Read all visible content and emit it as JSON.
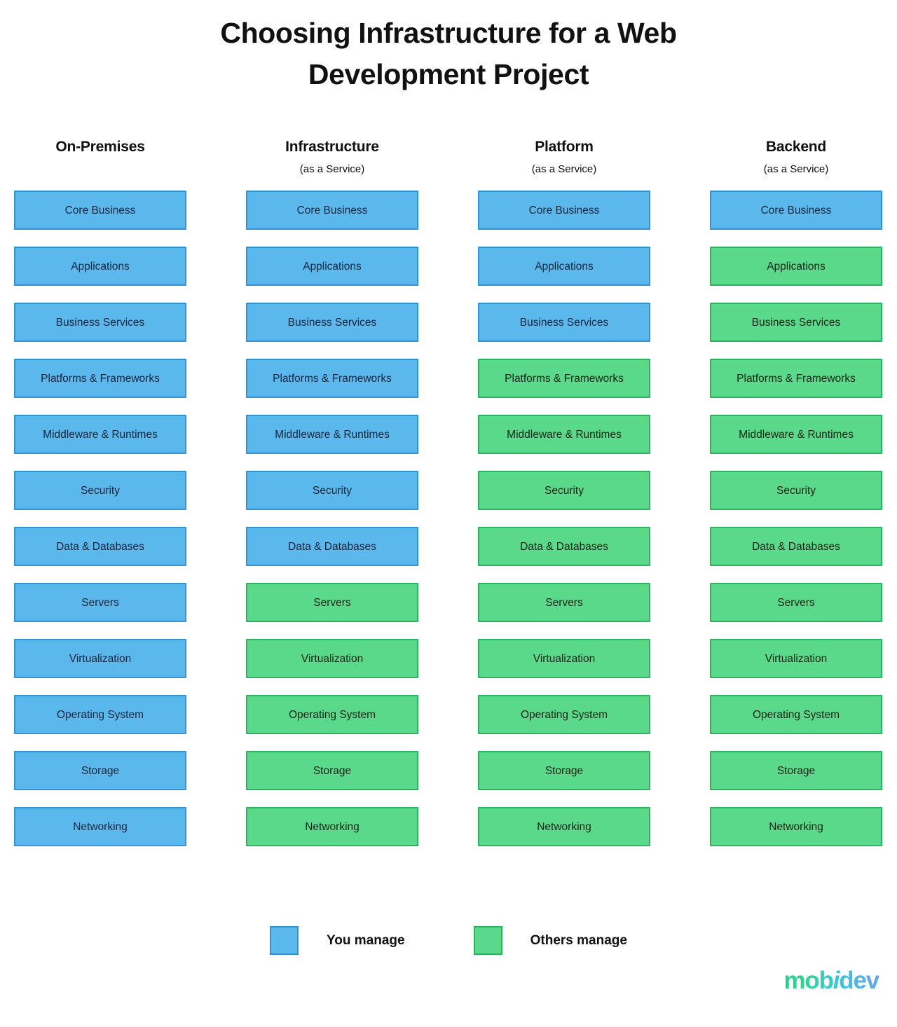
{
  "title": "Choosing Infrastructure for a Web Development Project",
  "colors": {
    "you_manage_fill": "#5BB8EC",
    "you_manage_border": "#2E96D4",
    "others_manage_fill": "#5BD98A",
    "others_manage_border": "#2CB45F",
    "title_text": "#111111",
    "logo_gradient_start": "#19D98F",
    "logo_gradient_end": "#63A7F2"
  },
  "chart_data": {
    "type": "heatmap",
    "title": "Choosing Infrastructure for a Web Development Project",
    "xlabel": "",
    "ylabel": "",
    "categories": [
      "On-Premises",
      "Infrastructure (as a Service)",
      "Platform (as a Service)",
      "Backend (as a Service)"
    ],
    "layers": [
      "Core Business",
      "Applications",
      "Business Services",
      "Platforms & Frameworks",
      "Middleware & Runtimes",
      "Security",
      "Data & Databases",
      "Servers",
      "Virtualization",
      "Operating System",
      "Storage",
      "Networking"
    ],
    "legend_position": "bottom-center",
    "legend": [
      "You manage",
      "Others manage"
    ],
    "series": [
      {
        "name": "On-Premises",
        "values": [
          "You manage",
          "You manage",
          "You manage",
          "You manage",
          "You manage",
          "You manage",
          "You manage",
          "You manage",
          "You manage",
          "You manage",
          "You manage",
          "You manage"
        ]
      },
      {
        "name": "Infrastructure (as a Service)",
        "values": [
          "You manage",
          "You manage",
          "You manage",
          "You manage",
          "You manage",
          "You manage",
          "You manage",
          "Others manage",
          "Others manage",
          "Others manage",
          "Others manage",
          "Others manage"
        ]
      },
      {
        "name": "Platform (as a Service)",
        "values": [
          "You manage",
          "You manage",
          "You manage",
          "Others manage",
          "Others manage",
          "Others manage",
          "Others manage",
          "Others manage",
          "Others manage",
          "Others manage",
          "Others manage",
          "Others manage"
        ]
      },
      {
        "name": "Backend (as a Service)",
        "values": [
          "You manage",
          "Others manage",
          "Others manage",
          "Others manage",
          "Others manage",
          "Others manage",
          "Others manage",
          "Others manage",
          "Others manage",
          "Others manage",
          "Others manage",
          "Others manage"
        ]
      }
    ]
  },
  "columns": [
    {
      "title": "On-Premises",
      "subtitle": "",
      "cells": [
        {
          "label": "Core Business",
          "owner": "you"
        },
        {
          "label": "Applications",
          "owner": "you"
        },
        {
          "label": "Business Services",
          "owner": "you"
        },
        {
          "label": "Platforms & Frameworks",
          "owner": "you"
        },
        {
          "label": "Middleware & Runtimes",
          "owner": "you"
        },
        {
          "label": "Security",
          "owner": "you"
        },
        {
          "label": "Data & Databases",
          "owner": "you"
        },
        {
          "label": "Servers",
          "owner": "you"
        },
        {
          "label": "Virtualization",
          "owner": "you"
        },
        {
          "label": "Operating System",
          "owner": "you"
        },
        {
          "label": "Storage",
          "owner": "you"
        },
        {
          "label": "Networking",
          "owner": "you"
        }
      ]
    },
    {
      "title": "Infrastructure",
      "subtitle": "(as a Service)",
      "cells": [
        {
          "label": "Core Business",
          "owner": "you"
        },
        {
          "label": "Applications",
          "owner": "you"
        },
        {
          "label": "Business Services",
          "owner": "you"
        },
        {
          "label": "Platforms & Frameworks",
          "owner": "you"
        },
        {
          "label": "Middleware & Runtimes",
          "owner": "you"
        },
        {
          "label": "Security",
          "owner": "you"
        },
        {
          "label": "Data & Databases",
          "owner": "you"
        },
        {
          "label": "Servers",
          "owner": "others"
        },
        {
          "label": "Virtualization",
          "owner": "others"
        },
        {
          "label": "Operating System",
          "owner": "others"
        },
        {
          "label": "Storage",
          "owner": "others"
        },
        {
          "label": "Networking",
          "owner": "others"
        }
      ]
    },
    {
      "title": "Platform",
      "subtitle": "(as a Service)",
      "cells": [
        {
          "label": "Core Business",
          "owner": "you"
        },
        {
          "label": "Applications",
          "owner": "you"
        },
        {
          "label": "Business Services",
          "owner": "you"
        },
        {
          "label": "Platforms & Frameworks",
          "owner": "others"
        },
        {
          "label": "Middleware & Runtimes",
          "owner": "others"
        },
        {
          "label": "Security",
          "owner": "others"
        },
        {
          "label": "Data & Databases",
          "owner": "others"
        },
        {
          "label": "Servers",
          "owner": "others"
        },
        {
          "label": "Virtualization",
          "owner": "others"
        },
        {
          "label": "Operating System",
          "owner": "others"
        },
        {
          "label": "Storage",
          "owner": "others"
        },
        {
          "label": "Networking",
          "owner": "others"
        }
      ]
    },
    {
      "title": "Backend",
      "subtitle": "(as a Service)",
      "cells": [
        {
          "label": "Core Business",
          "owner": "you"
        },
        {
          "label": "Applications",
          "owner": "others"
        },
        {
          "label": "Business Services",
          "owner": "others"
        },
        {
          "label": "Platforms & Frameworks",
          "owner": "others"
        },
        {
          "label": "Middleware & Runtimes",
          "owner": "others"
        },
        {
          "label": "Security",
          "owner": "others"
        },
        {
          "label": "Data & Databases",
          "owner": "others"
        },
        {
          "label": "Servers",
          "owner": "others"
        },
        {
          "label": "Virtualization",
          "owner": "others"
        },
        {
          "label": "Operating System",
          "owner": "others"
        },
        {
          "label": "Storage",
          "owner": "others"
        },
        {
          "label": "Networking",
          "owner": "others"
        }
      ]
    }
  ],
  "legend": {
    "items": [
      {
        "label": "You manage",
        "owner": "you"
      },
      {
        "label": "Others manage",
        "owner": "others"
      }
    ]
  },
  "logo": {
    "part1": "mob",
    "part2": "i",
    "part3": "dev"
  }
}
